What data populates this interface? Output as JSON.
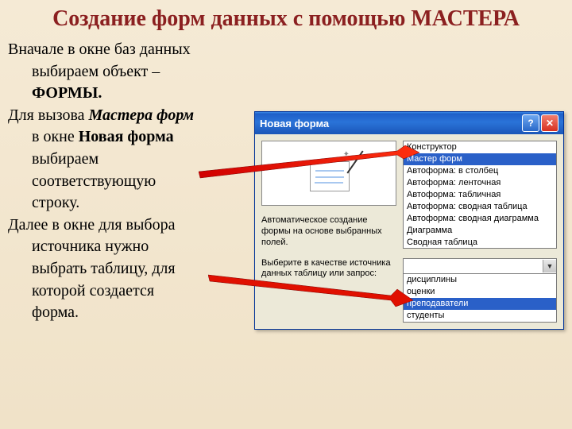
{
  "title": "Создание форм данных с помощью МАСТЕРА",
  "para": {
    "p1a": "Вначале в окне баз данных",
    "p1b": "выбираем объект –",
    "p1c": "ФОРМЫ.",
    "p2a": "Для вызова ",
    "p2b": "Мастера форм",
    "p2c": "в окне ",
    "p2d": "Новая форма",
    "p2e": "выбираем",
    "p2f": "соответствующую",
    "p2g": "строку.",
    "p3a": "Далее в окне для выбора",
    "p3b": "источника нужно",
    "p3c": "выбрать таблицу, для",
    "p3d": "которой создается",
    "p3e": "форма."
  },
  "dialog": {
    "title": "Новая форма",
    "desc": "Автоматическое создание формы на основе выбранных полей.",
    "types": [
      "Конструктор",
      "Мастер форм",
      "Автоформа: в столбец",
      "Автоформа: ленточная",
      "Автоформа: табличная",
      "Автоформа:  сводная таблица",
      "Автоформа:  сводная диаграмма",
      "Диаграмма",
      "Сводная таблица"
    ],
    "selectedTypeIndex": 1,
    "sourcePrompt": "Выберите в качестве источника данных таблицу или запрос:",
    "sources": [
      "дисциплины",
      "оценки",
      "преподаватели",
      "студенты"
    ],
    "selectedSourceIndex": 2
  },
  "colors": {
    "accent": "#2a60c8",
    "titlebar": "#1e5fc8",
    "slideTitle": "#8b2020"
  }
}
